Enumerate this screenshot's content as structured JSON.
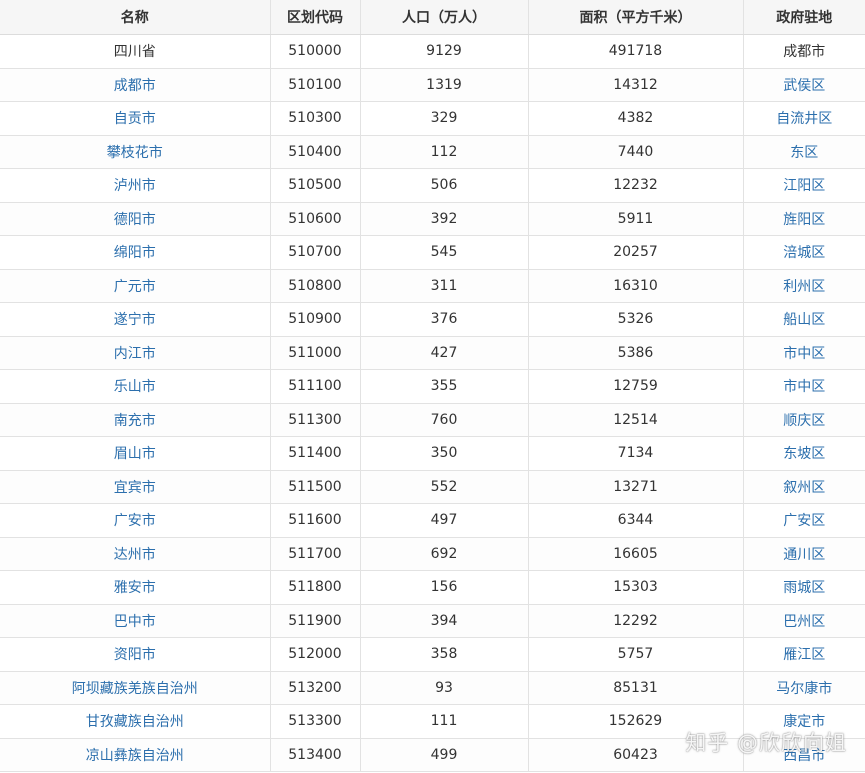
{
  "headers": {
    "name": "名称",
    "code": "区划代码",
    "population": "人口（万人）",
    "area": "面积（平方千米）",
    "seat": "政府驻地"
  },
  "rows": [
    {
      "name": "四川省",
      "code": "510000",
      "population": "9129",
      "area": "491718",
      "seat": "成都市"
    },
    {
      "name": "成都市",
      "code": "510100",
      "population": "1319",
      "area": "14312",
      "seat": "武侯区"
    },
    {
      "name": "自贡市",
      "code": "510300",
      "population": "329",
      "area": "4382",
      "seat": "自流井区"
    },
    {
      "name": "攀枝花市",
      "code": "510400",
      "population": "112",
      "area": "7440",
      "seat": "东区"
    },
    {
      "name": "泸州市",
      "code": "510500",
      "population": "506",
      "area": "12232",
      "seat": "江阳区"
    },
    {
      "name": "德阳市",
      "code": "510600",
      "population": "392",
      "area": "5911",
      "seat": "旌阳区"
    },
    {
      "name": "绵阳市",
      "code": "510700",
      "population": "545",
      "area": "20257",
      "seat": "涪城区"
    },
    {
      "name": "广元市",
      "code": "510800",
      "population": "311",
      "area": "16310",
      "seat": "利州区"
    },
    {
      "name": "遂宁市",
      "code": "510900",
      "population": "376",
      "area": "5326",
      "seat": "船山区"
    },
    {
      "name": "内江市",
      "code": "511000",
      "population": "427",
      "area": "5386",
      "seat": "市中区"
    },
    {
      "name": "乐山市",
      "code": "511100",
      "population": "355",
      "area": "12759",
      "seat": "市中区"
    },
    {
      "name": "南充市",
      "code": "511300",
      "population": "760",
      "area": "12514",
      "seat": "顺庆区"
    },
    {
      "name": "眉山市",
      "code": "511400",
      "population": "350",
      "area": "7134",
      "seat": "东坡区"
    },
    {
      "name": "宜宾市",
      "code": "511500",
      "population": "552",
      "area": "13271",
      "seat": "叙州区"
    },
    {
      "name": "广安市",
      "code": "511600",
      "population": "497",
      "area": "6344",
      "seat": "广安区"
    },
    {
      "name": "达州市",
      "code": "511700",
      "population": "692",
      "area": "16605",
      "seat": "通川区"
    },
    {
      "name": "雅安市",
      "code": "511800",
      "population": "156",
      "area": "15303",
      "seat": "雨城区"
    },
    {
      "name": "巴中市",
      "code": "511900",
      "population": "394",
      "area": "12292",
      "seat": "巴州区"
    },
    {
      "name": "资阳市",
      "code": "512000",
      "population": "358",
      "area": "5757",
      "seat": "雁江区"
    },
    {
      "name": "阿坝藏族羌族自治州",
      "code": "513200",
      "population": "93",
      "area": "85131",
      "seat": "马尔康市"
    },
    {
      "name": "甘孜藏族自治州",
      "code": "513300",
      "population": "111",
      "area": "152629",
      "seat": "康定市"
    },
    {
      "name": "凉山彝族自治州",
      "code": "513400",
      "population": "499",
      "area": "60423",
      "seat": "西昌市"
    }
  ],
  "watermark": "知乎 @欣欣向姐",
  "colors": {
    "link": "#2c6fad",
    "header_bg": "#f6f6f6",
    "border": "#e2e2e2"
  }
}
